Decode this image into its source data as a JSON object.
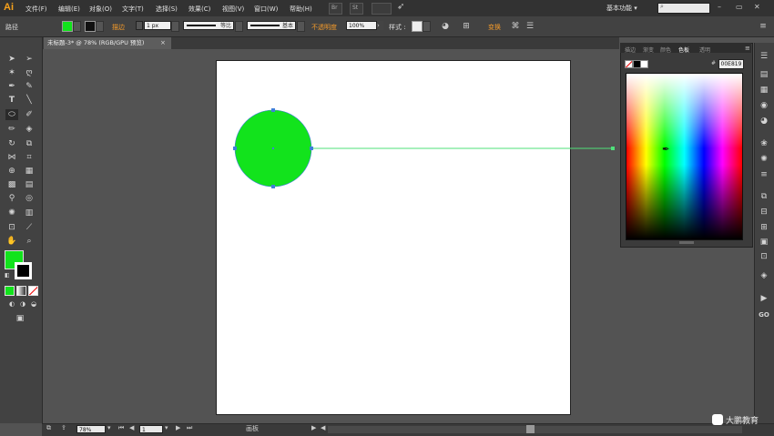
{
  "app": {
    "logo": "Ai"
  },
  "menu": [
    "文件(F)",
    "编辑(E)",
    "对象(O)",
    "文字(T)",
    "选择(S)",
    "效果(C)",
    "视图(V)",
    "窗口(W)",
    "帮助(H)"
  ],
  "topbar": {
    "workspace": "基本功能",
    "br_label": "Br",
    "st_label": "St"
  },
  "control": {
    "object_type": "路径",
    "stroke_label": "描边",
    "stroke_weight": "1 px",
    "profile_label": "等比",
    "brush_label": "基本",
    "opacity_label": "不透明度",
    "opacity_value": "100%",
    "style_label": "样式",
    "transform_label": "变换"
  },
  "document": {
    "tab_title": "未标题-3* @ 78% (RGB/GPU 预览)",
    "close": "×"
  },
  "panel": {
    "tabs": [
      "描边",
      "渐变",
      "颜色",
      "色板",
      "透明"
    ],
    "active_tab": "颜色",
    "hex_value": "00E819",
    "hash": "#"
  },
  "status": {
    "zoom": "78%",
    "artboard_number": "1",
    "mode": "画板"
  },
  "watermark": "大鹏教育",
  "colors": {
    "fill": "#12E31C",
    "guide": "#4fe07a",
    "accent": "#f39a2a"
  }
}
